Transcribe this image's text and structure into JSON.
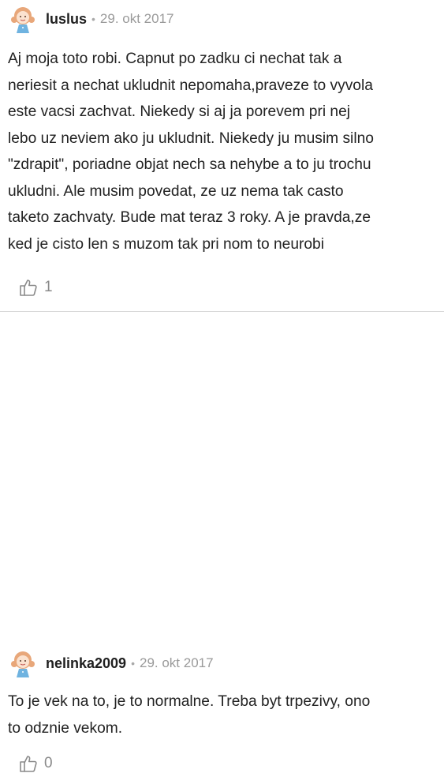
{
  "comments": [
    {
      "author": "luslus",
      "separator": "•",
      "date": "29. okt 2017",
      "text": "Aj moja toto robi. Capnut po zadku ci nechat tak a\nneriesit a nechat ukludnit nepomaha,praveze to vyvola\neste vacsi zachvat. Niekedy si aj ja porevem pri nej\nlebo uz neviem ako ju ukludnit. Niekedy ju musim silno\n\"zdrapit\", poriadne objat nech sa nehybe a to ju trochu\nukludni. Ale musim povedat, ze uz nema tak casto\ntaketo zachvaty. Bude mat teraz 3 roky. A je pravda,ze\nked je cisto len s muzom tak pri nom to neurobi",
      "likes": "1",
      "icons": {
        "avatar": "girl-avatar-icon",
        "like": "thumbs-up-icon"
      }
    },
    {
      "author": "nelinka2009",
      "separator": "•",
      "date": "29. okt 2017",
      "text": "To je vek na to, je to normalne. Treba byt trpezivy, ono\nto odznie vekom.",
      "likes": "0",
      "icons": {
        "avatar": "girl-avatar-icon",
        "like": "thumbs-up-icon"
      }
    }
  ],
  "colors": {
    "text": "#222222",
    "muted": "#9a9a9a",
    "divider": "#d9d9d9",
    "avatar_hair": "#e8a77a",
    "avatar_dress": "#6fb3e0"
  }
}
